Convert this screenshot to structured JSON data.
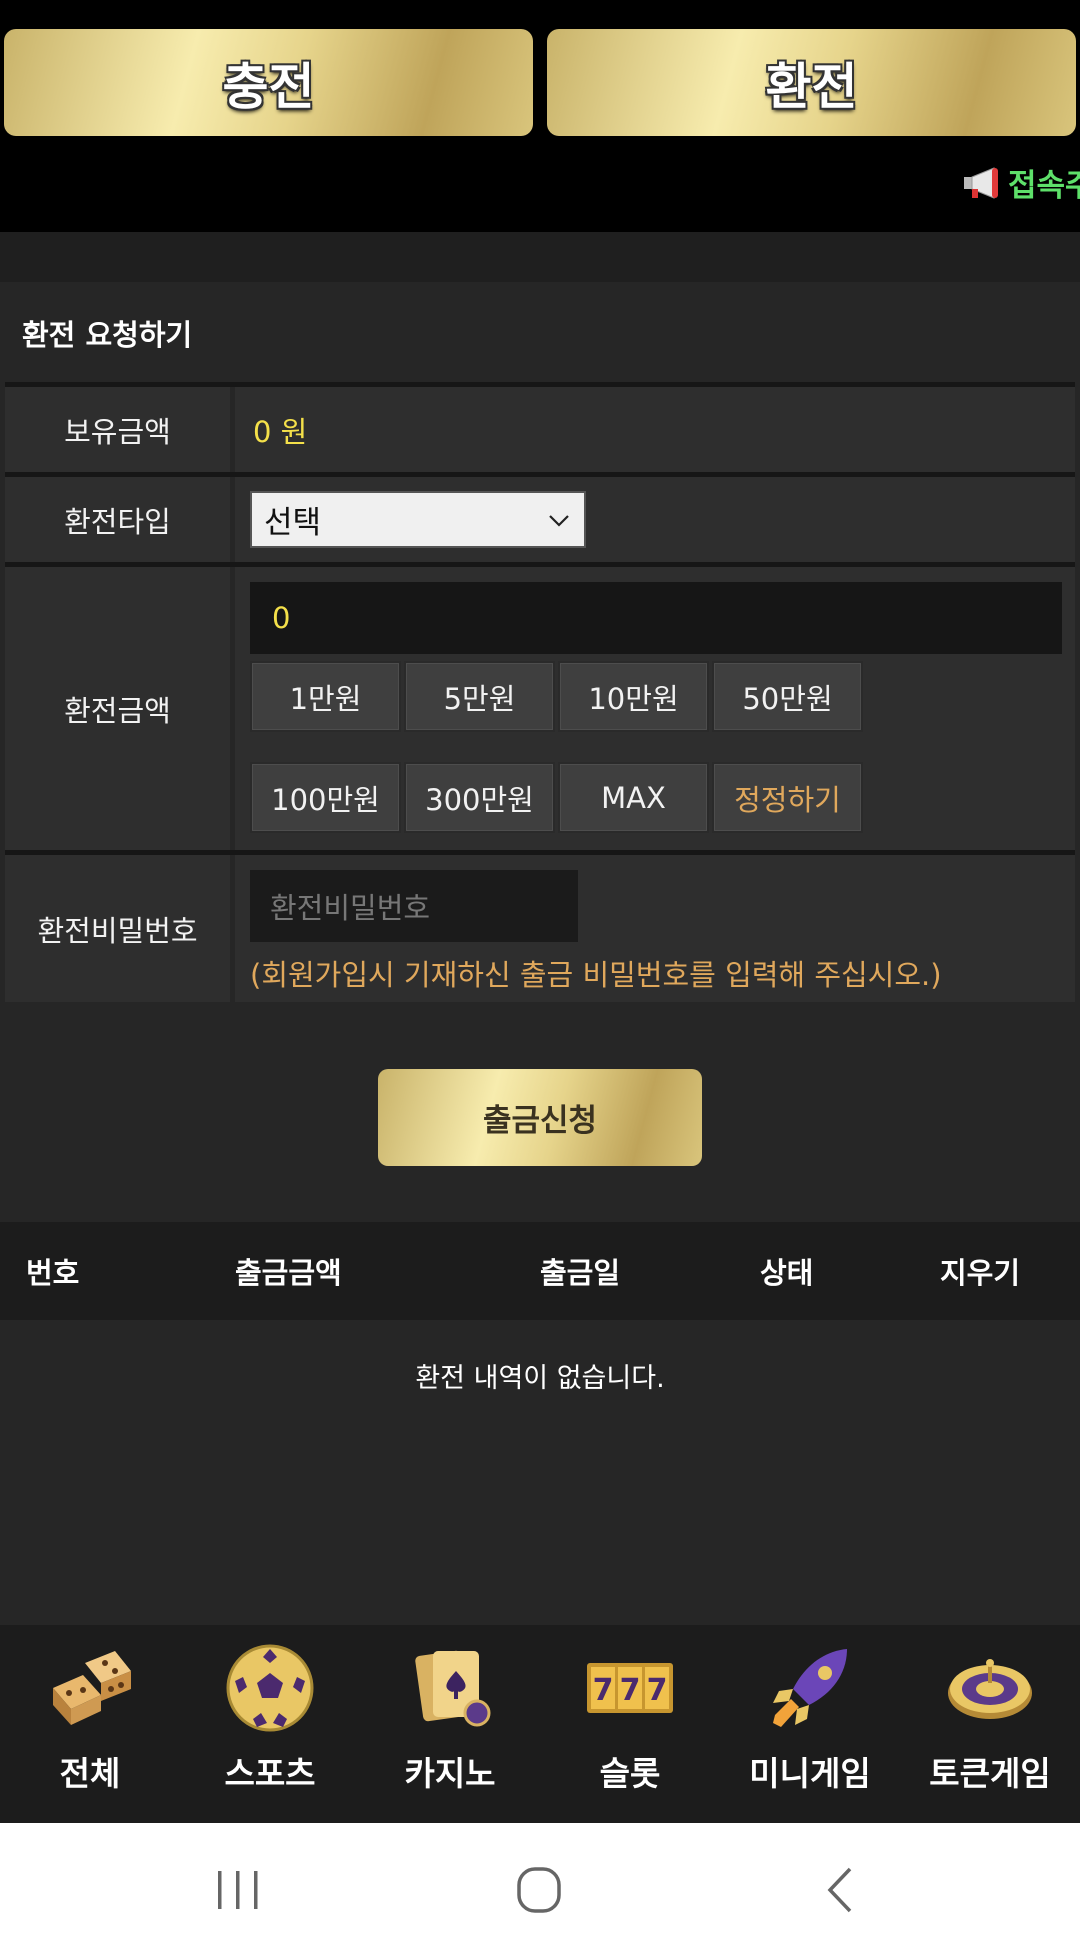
{
  "top": {
    "deposit_label": "충전",
    "withdraw_label": "환전",
    "marquee_text": "접속주"
  },
  "form": {
    "title": "환전 요청하기",
    "balance_label": "보유금액",
    "balance_value": "0 원",
    "type_label": "환전타입",
    "type_selected": "선택",
    "amount_label": "환전금액",
    "amount_value": "0",
    "amount_buttons": [
      "1만원",
      "5만원",
      "10만원",
      "50만원",
      "100만원",
      "300만원",
      "MAX",
      "정정하기"
    ],
    "password_label": "환전비밀번호",
    "password_placeholder": "환전비밀번호",
    "password_note": "(회원가입시 기재하신 출금 비밀번호를 입력해 주십시오.)",
    "submit_label": "출금신청"
  },
  "history": {
    "columns": [
      "번호",
      "출금금액",
      "출금일",
      "상태",
      "지우기"
    ],
    "empty_text": "환전 내역이 없습니다."
  },
  "nav": {
    "items": [
      {
        "label": "전체",
        "icon": "dice-icon"
      },
      {
        "label": "스포츠",
        "icon": "soccer-ball-icon"
      },
      {
        "label": "카지노",
        "icon": "cards-icon"
      },
      {
        "label": "슬롯",
        "icon": "slot-777-icon"
      },
      {
        "label": "미니게임",
        "icon": "rocket-icon"
      },
      {
        "label": "토큰게임",
        "icon": "roulette-icon"
      }
    ]
  },
  "colors": {
    "gold": "#e6d48b",
    "accent_yellow": "#f4e04a",
    "accent_orange": "#e0a85c",
    "marquee_green": "#5ee06a"
  }
}
